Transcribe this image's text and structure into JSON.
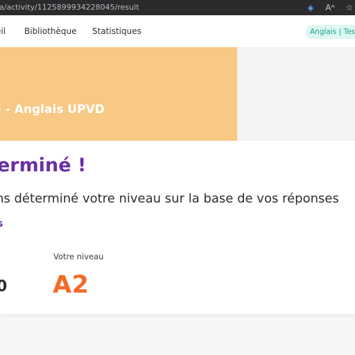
{
  "browser": {
    "url": "a/activity/1125899934228045/result",
    "icons": [
      "tag-icon",
      "read-aloud-icon",
      "star-icon"
    ]
  },
  "nav": {
    "items": [
      {
        "label": "eil"
      },
      {
        "label": "Bibliothèque"
      },
      {
        "label": "Statistiques"
      }
    ],
    "badge": "Anglais | Test"
  },
  "banner": {
    "title": "i - Anglais UPVD",
    "color": "#f7c985"
  },
  "result": {
    "headline": "erminé !",
    "description": "ns déterminé votre niveau sur la base de vos réponses",
    "small_text": "s",
    "score_fragment": "0",
    "level_label": "Votre niveau",
    "level_value": "A2",
    "level_color": "#f26b2a",
    "headline_color": "#6a2fa3"
  }
}
